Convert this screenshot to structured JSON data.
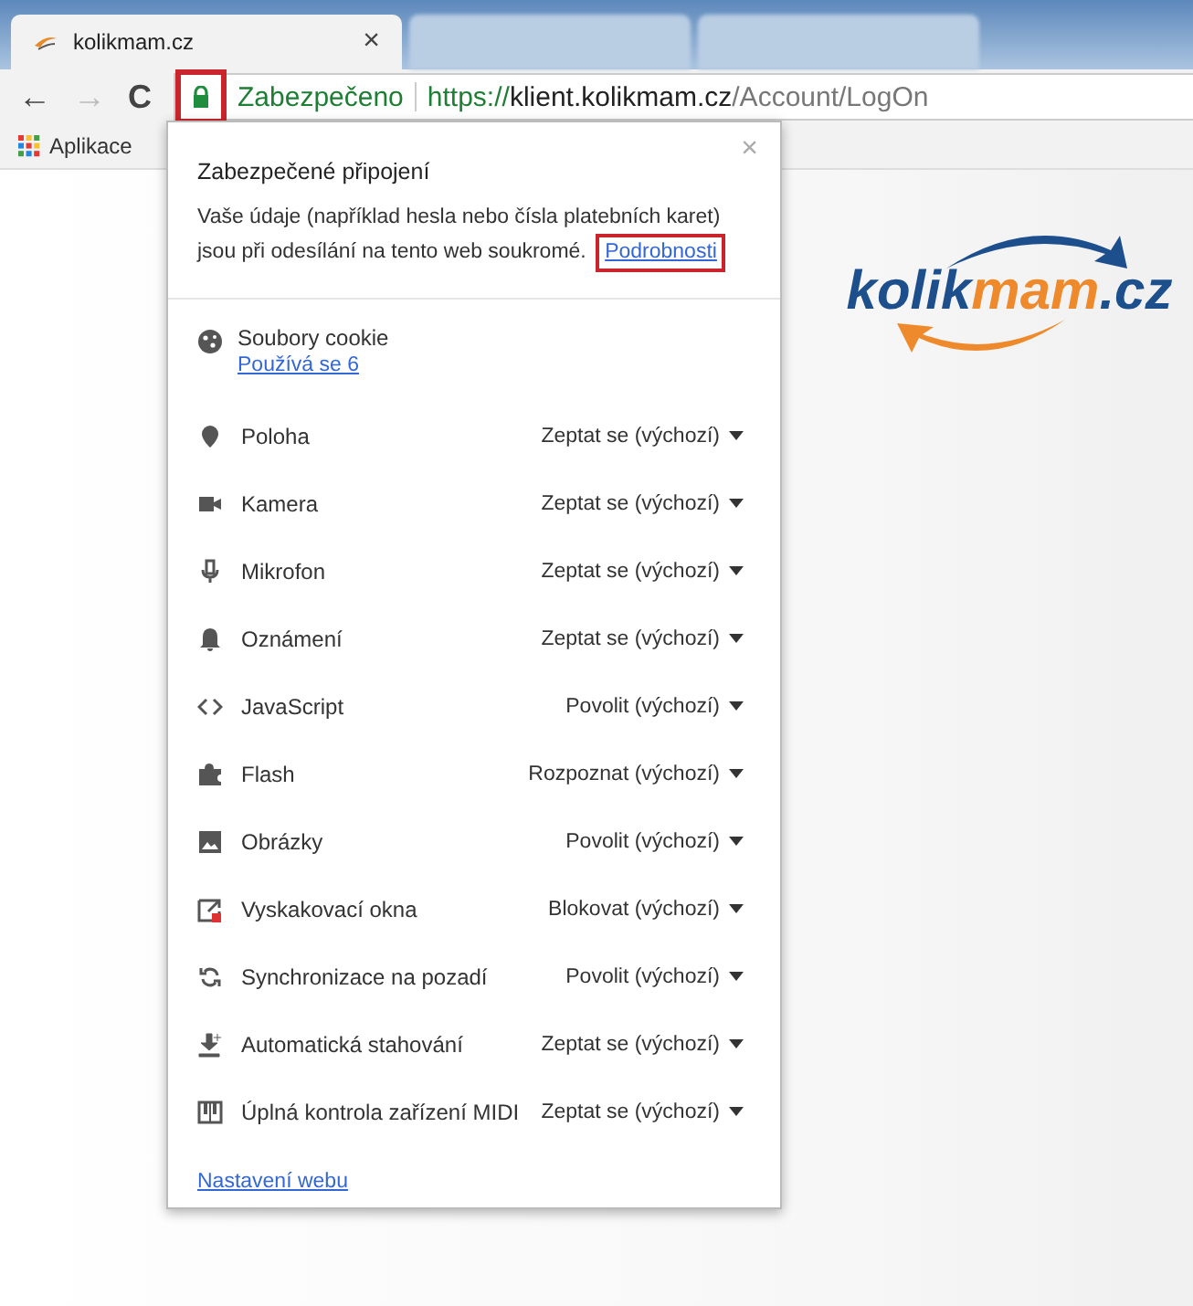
{
  "tabs": [
    {
      "title": "kolikmam.cz",
      "close": "×",
      "selected": true
    },
    {
      "selected": false
    },
    {
      "selected": false
    }
  ],
  "address_bar": {
    "back": "←",
    "forward": "→",
    "reload": "C",
    "lock_highlighted": true,
    "security": "Zabezpečeno",
    "url_scheme": "https://",
    "url_host": "klient.kolikmam.cz",
    "url_path": "/Account/LogOn"
  },
  "bookmarks": [
    {
      "label": "Aplikace"
    }
  ],
  "popup": {
    "close": "×",
    "title": "Zabezpečené připojení",
    "description": "Vaše údaje (například hesla nebo čísla platebních karet) jsou při odesílání na tento web soukromé.",
    "details_link": "Podrobnosti",
    "details_highlighted": true,
    "cookies": {
      "label": "Soubory cookie",
      "link": "Používá se 6"
    },
    "permissions": [
      {
        "label": "Poloha",
        "value": "Zeptat se (výchozí)"
      },
      {
        "label": "Kamera",
        "value": "Zeptat se (výchozí)"
      },
      {
        "label": "Mikrofon",
        "value": "Zeptat se (výchozí)"
      },
      {
        "label": "Oznámení",
        "value": "Zeptat se (výchozí)"
      },
      {
        "label": "JavaScript",
        "value": "Povolit (výchozí)"
      },
      {
        "label": "Flash",
        "value": "Rozpoznat (výchozí)"
      },
      {
        "label": "Obrázky",
        "value": "Povolit (výchozí)"
      },
      {
        "label": "Vyskakovací okna",
        "value": "Blokovat (výchozí)"
      },
      {
        "label": "Synchronizace na pozadí",
        "value": "Povolit (výchozí)"
      },
      {
        "label": "Automatická stahování",
        "value": "Zeptat se (výchozí)"
      },
      {
        "label": "Úplná kontrola zařízení MIDI",
        "value": "Zeptat se (výchozí)"
      }
    ],
    "settings_link": "Nastavení webu"
  },
  "logo": {
    "part_1": "kolik",
    "part_2": "mam",
    "part_3": ".cz"
  }
}
